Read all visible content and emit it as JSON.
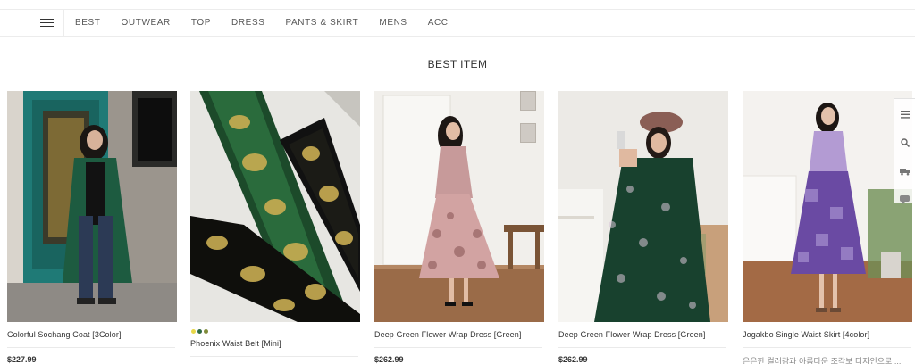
{
  "nav": {
    "items": [
      "BEST",
      "OUTWEAR",
      "TOP",
      "DRESS",
      "PANTS & SKIRT",
      "MENS",
      "ACC"
    ]
  },
  "section": {
    "title": "BEST ITEM"
  },
  "products": [
    {
      "name": "Colorful Sochang Coat [3Color]",
      "price": "$227.99"
    },
    {
      "name": "Phoenix Waist Belt [Mini]",
      "swatches": [
        "#e8d84a",
        "#2e6a44",
        "#7f8b3a"
      ]
    },
    {
      "name": "Deep Green Flower Wrap Dress [Green]",
      "price": "$262.99"
    },
    {
      "name": "Deep Green Flower Wrap Dress [Green]",
      "price": "$262.99"
    },
    {
      "name": "Jogakbo Single Waist Skirt [4color]",
      "desc": "은은한 컬러감과 아름다운 조각보 디자인으로 ..."
    }
  ],
  "sidebar_icons": [
    "list-icon",
    "search-icon",
    "truck-icon",
    "chat-icon"
  ]
}
